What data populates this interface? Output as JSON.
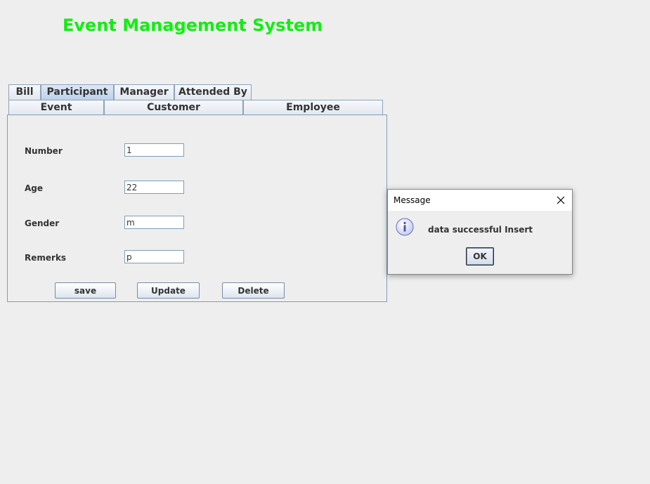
{
  "app": {
    "title": "Event Management System"
  },
  "tabs": {
    "row_top": [
      {
        "label": "Bill",
        "selected": false
      },
      {
        "label": "Participant",
        "selected": true
      },
      {
        "label": "Manager",
        "selected": false
      },
      {
        "label": "Attended By",
        "selected": false
      }
    ],
    "row_bottom": [
      {
        "label": "Event",
        "selected": false
      },
      {
        "label": "Customer",
        "selected": false
      },
      {
        "label": "Employee",
        "selected": false
      }
    ]
  },
  "form": {
    "fields": [
      {
        "label": "Number",
        "value": "1"
      },
      {
        "label": "Age",
        "value": "22"
      },
      {
        "label": "Gender",
        "value": "m"
      },
      {
        "label": "Remerks",
        "value": "p"
      }
    ],
    "buttons": {
      "save": "save",
      "update": "Update",
      "delete": "Delete"
    }
  },
  "dialog": {
    "title": "Message",
    "message": "data successful Insert",
    "ok_label": "OK",
    "icon": "info-icon"
  },
  "colors": {
    "title": "#11ee11",
    "background": "#eeeeee",
    "selected_tab": "#c7d8ee"
  }
}
